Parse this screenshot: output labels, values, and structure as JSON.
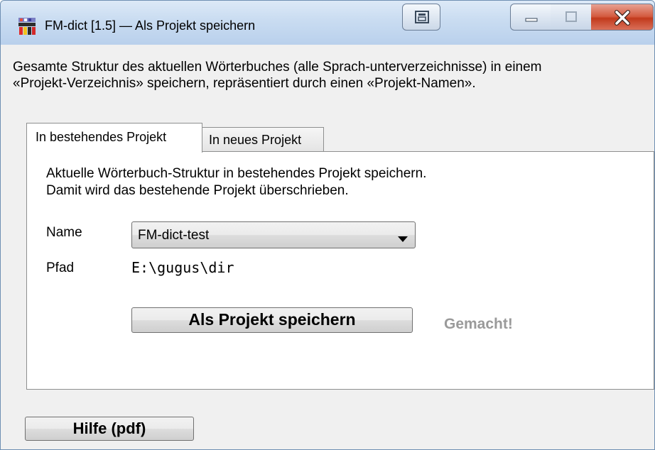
{
  "window": {
    "title": "FM-dict [1.5] — Als Projekt speichern"
  },
  "description": {
    "line1": "Gesamte Struktur des aktuellen Wörterbuches (alle Sprach-unterverzeichnisse) in einem",
    "line2": "«Projekt-Verzeichnis» speichern, repräsentiert durch einen «Projekt-Namen»."
  },
  "tabs": [
    {
      "label": "In bestehendes Projekt",
      "selected": true
    },
    {
      "label": "In neues Projekt",
      "selected": false
    }
  ],
  "panel": {
    "line1": "Aktuelle Wörterbuch-Struktur in bestehendes Projekt speichern.",
    "line2": "Damit wird das bestehende Projekt überschrieben.",
    "name_label": "Name",
    "name_value": "FM-dict-test",
    "path_label": "Pfad",
    "path_value": "E:\\gugus\\dir",
    "save_button": "Als Projekt speichern",
    "status": "Gemacht!"
  },
  "footer": {
    "help_button": "Hilfe (pdf)"
  },
  "colors": {
    "close_button": "#c7432a",
    "status_text": "#9a9a9a",
    "titlebar": "#c9dcf1"
  }
}
